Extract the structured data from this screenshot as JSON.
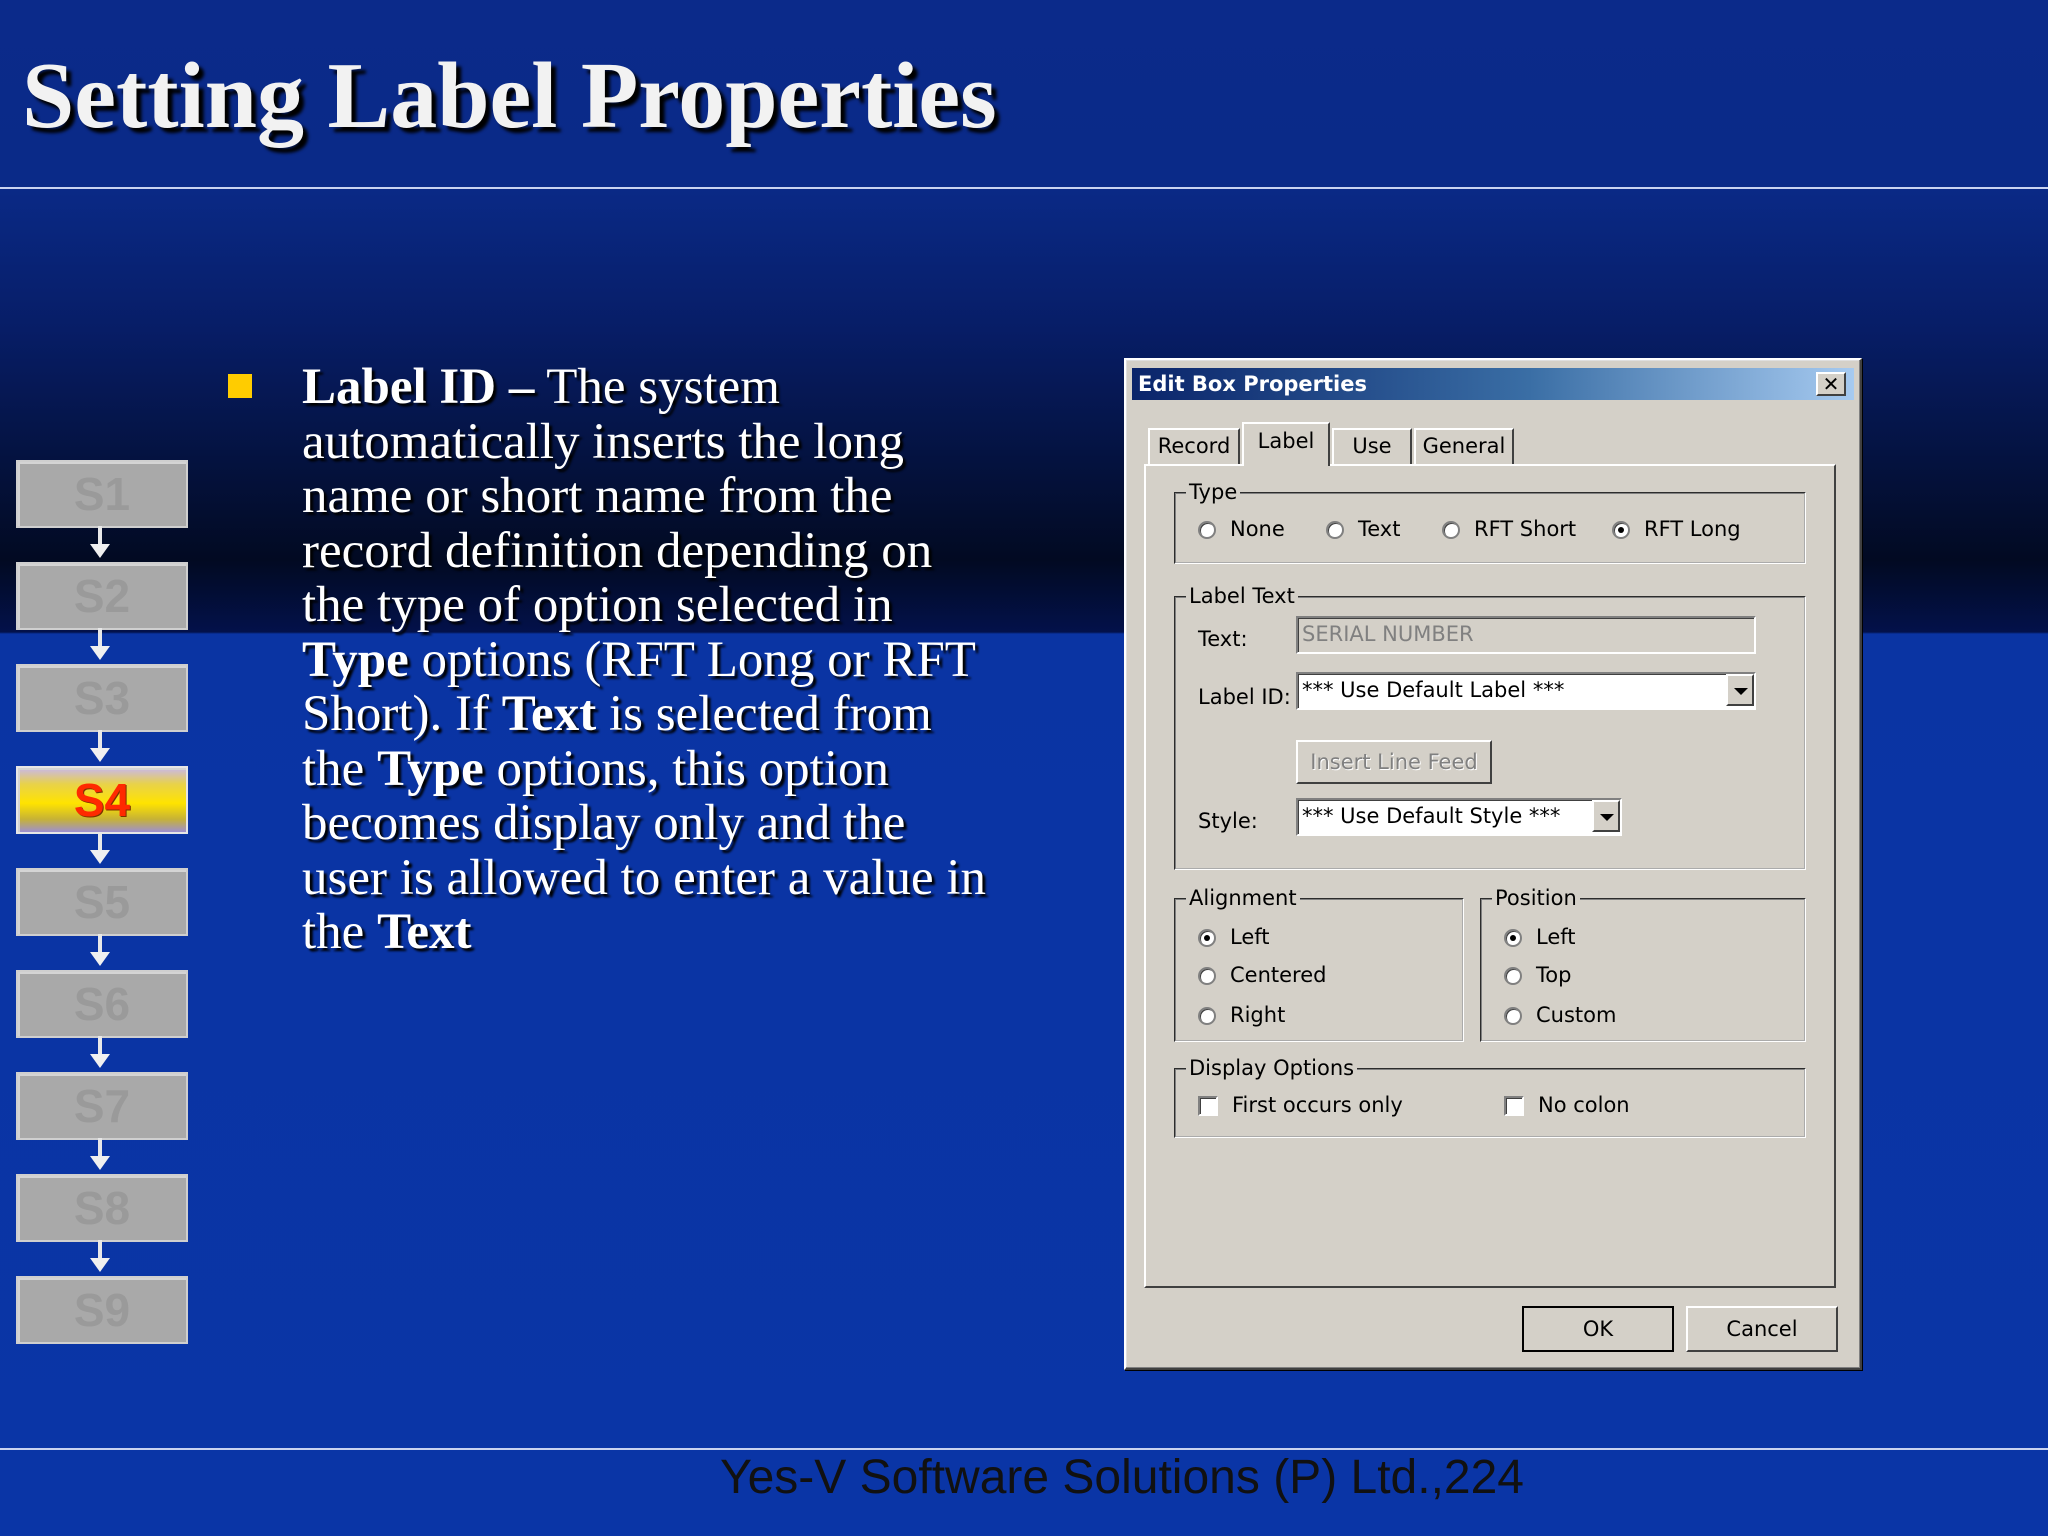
{
  "slide": {
    "title": "Setting Label Properties",
    "footer": "Yes-V Software Solutions (P) Ltd.,224"
  },
  "steps": [
    {
      "label": "S1",
      "active": false
    },
    {
      "label": "S2",
      "active": false
    },
    {
      "label": "S3",
      "active": false
    },
    {
      "label": "S4",
      "active": true
    },
    {
      "label": "S5",
      "active": false
    },
    {
      "label": "S6",
      "active": false
    },
    {
      "label": "S7",
      "active": false
    },
    {
      "label": "S8",
      "active": false
    },
    {
      "label": "S9",
      "active": false
    }
  ],
  "bullet": {
    "term": "Label ID –",
    "part1": " The system automatically inserts the long name or short name from the record definition depending on the type of option selected in ",
    "type1": "Type",
    "part2": " options (RFT Long or RFT Short). If ",
    "text1": "Text",
    "part3": " is selected from the ",
    "type2": "Type",
    "part4": " options, this option becomes display only and the user is allowed to enter a value in the ",
    "text2": "Text"
  },
  "dialog": {
    "title": "Edit Box Properties",
    "close_glyph": "✕",
    "tabs": [
      "Record",
      "Label",
      "Use",
      "General"
    ],
    "active_tab": "Label",
    "type_group": {
      "label": "Type",
      "options": [
        "None",
        "Text",
        "RFT Short",
        "RFT Long"
      ],
      "selected": "RFT Long"
    },
    "label_text_group": {
      "label": "Label Text",
      "text_label": "Text:",
      "text_value": "SERIAL NUMBER",
      "label_id_label": "Label ID:",
      "label_id_value": "*** Use Default Label ***",
      "insert_line_feed": "Insert Line Feed",
      "style_label": "Style:",
      "style_value": "*** Use Default Style ***"
    },
    "alignment_group": {
      "label": "Alignment",
      "options": [
        "Left",
        "Centered",
        "Right"
      ],
      "selected": "Left"
    },
    "position_group": {
      "label": "Position",
      "options": [
        "Left",
        "Top",
        "Custom"
      ],
      "selected": "Left"
    },
    "display_options_group": {
      "label": "Display Options",
      "first_occurs_only": "First occurs only",
      "no_colon": "No colon"
    },
    "ok_label": "OK",
    "cancel_label": "Cancel"
  }
}
